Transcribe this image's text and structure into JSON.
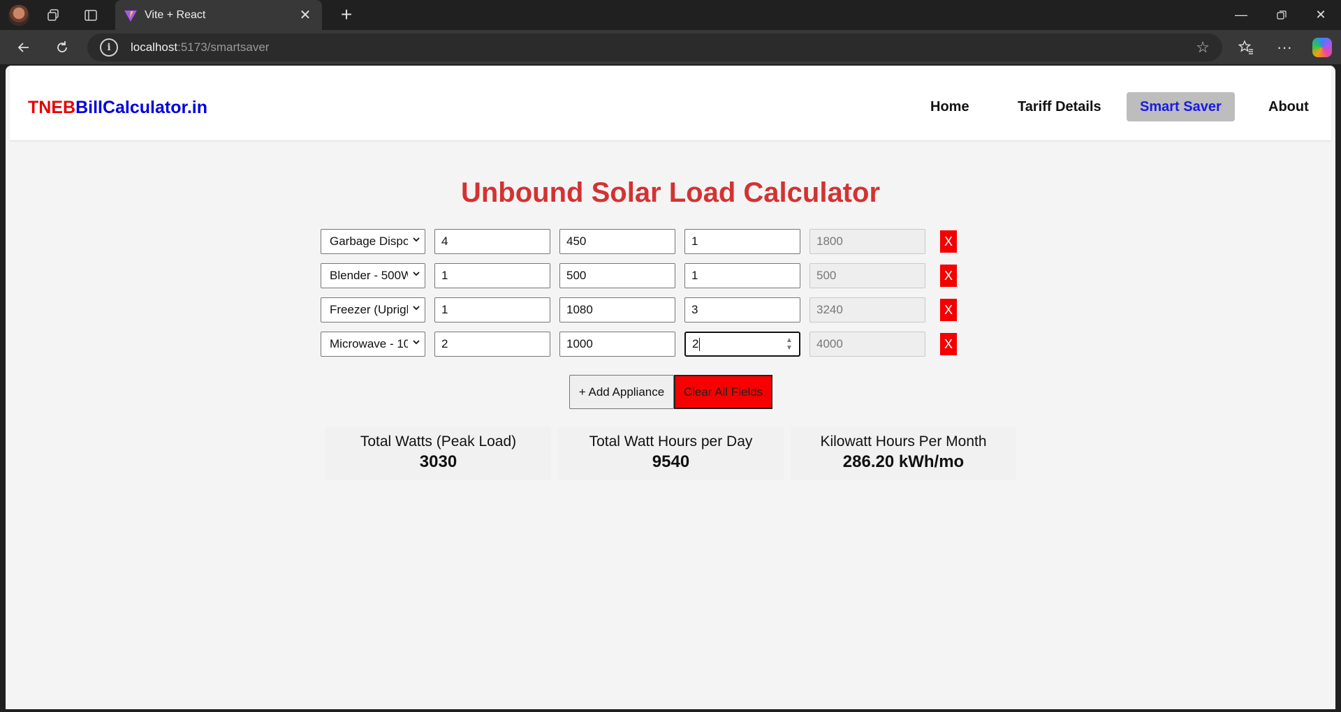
{
  "browser": {
    "tab_title": "Vite + React",
    "url_host": "localhost",
    "url_path": ":5173/smartsaver"
  },
  "site": {
    "logo_red": "TNEB",
    "logo_blue": "BillCalculator.in",
    "nav": [
      {
        "label": "Home",
        "active": false
      },
      {
        "label": "Tariff Details",
        "active": false
      },
      {
        "label": "Smart Saver",
        "active": true
      },
      {
        "label": "About",
        "active": false
      }
    ]
  },
  "calculator": {
    "title": "Unbound Solar Load Calculator",
    "rows": [
      {
        "appliance": "Garbage Dispo",
        "quantity": "4",
        "watts": "450",
        "hours": "1",
        "watt_hours": "1800",
        "remove_label": "X"
      },
      {
        "appliance": "Blender - 500W",
        "quantity": "1",
        "watts": "500",
        "hours": "1",
        "watt_hours": "500",
        "remove_label": "X"
      },
      {
        "appliance": "Freezer (Uprigh",
        "quantity": "1",
        "watts": "1080",
        "hours": "3",
        "watt_hours": "3240",
        "remove_label": "X"
      },
      {
        "appliance": "Microwave - 10",
        "quantity": "2",
        "watts": "1000",
        "hours": "2",
        "watt_hours": "4000",
        "remove_label": "X"
      }
    ],
    "add_label": "+ Add Appliance",
    "clear_label": "Clear All Fields",
    "stats": [
      {
        "label": "Total Watts (Peak Load)",
        "value": "3030"
      },
      {
        "label": "Total Watt Hours per Day",
        "value": "9540"
      },
      {
        "label": "Kilowatt Hours Per Month",
        "value": "286.20 kWh/mo"
      }
    ]
  },
  "colors": {
    "title": "#d43232",
    "danger": "#f40000",
    "active_nav_bg": "#bdbdbd",
    "active_nav_text": "#1a1ae6"
  }
}
